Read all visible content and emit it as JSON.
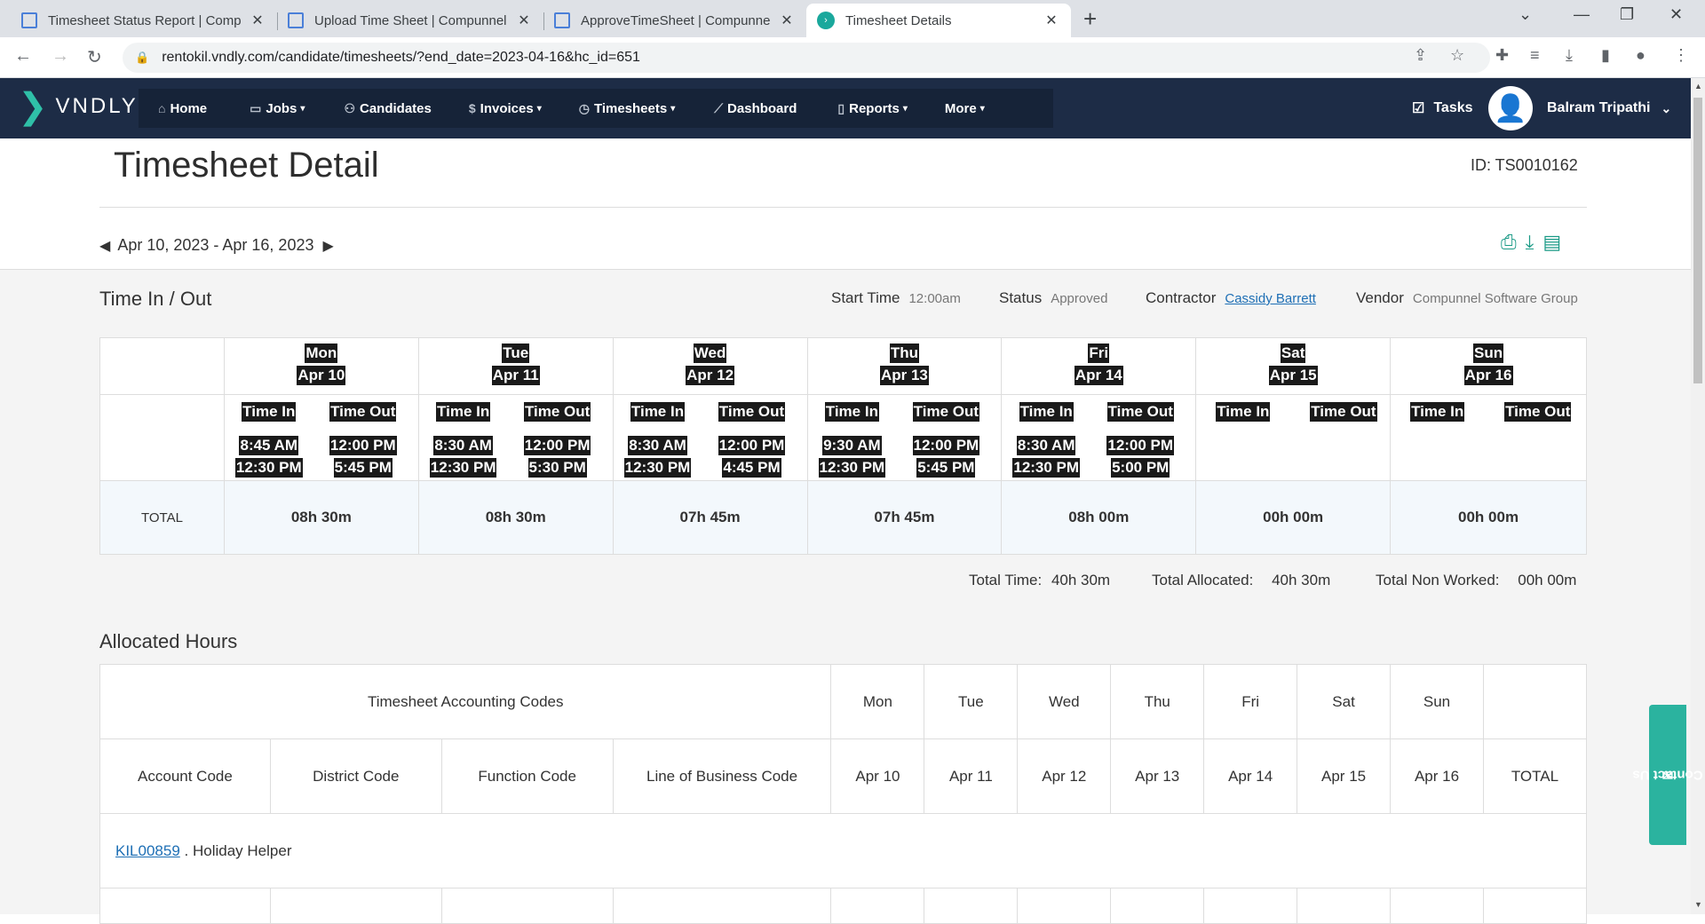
{
  "browser": {
    "tabs": [
      {
        "title": "Timesheet Status Report | Compunnel",
        "active": false
      },
      {
        "title": "Upload Time Sheet | Compunnel",
        "active": false
      },
      {
        "title": "ApproveTimeSheet | Compunnel",
        "active": false
      },
      {
        "title": "Timesheet Details",
        "active": true
      }
    ],
    "url": "rentokil.vndly.com/candidate/timesheets/?end_date=2023-04-16&hc_id=651"
  },
  "header": {
    "logo": "VNDLY",
    "menu": [
      {
        "label": "Home",
        "icon": "home-icon",
        "caret": false
      },
      {
        "label": "Jobs",
        "icon": "briefcase-icon",
        "caret": true
      },
      {
        "label": "Candidates",
        "icon": "user-icon",
        "caret": false
      },
      {
        "label": "Invoices",
        "icon": "dollar-icon",
        "caret": true
      },
      {
        "label": "Timesheets",
        "icon": "clock-icon",
        "caret": true
      },
      {
        "label": "Dashboard",
        "icon": "chart-icon",
        "caret": false
      },
      {
        "label": "Reports",
        "icon": "document-icon",
        "caret": true
      },
      {
        "label": "More",
        "icon": "",
        "caret": true
      }
    ],
    "tasks_label": "Tasks",
    "user_name": "Balram Tripathi"
  },
  "page": {
    "title": "Timesheet Detail",
    "id_label": "ID: TS0010162",
    "period": "Apr 10, 2023 - Apr 16, 2023"
  },
  "time_in_out": {
    "section_title": "Time In / Out",
    "start_time_label": "Start Time",
    "start_time_value": "12:00am",
    "status_label": "Status",
    "status_value": "Approved",
    "contractor_label": "Contractor",
    "contractor_value": "Cassidy Barrett",
    "vendor_label": "Vendor",
    "vendor_value": "Compunnel Software Group",
    "time_in_label": "Time In",
    "time_out_label": "Time Out",
    "total_label": "TOTAL",
    "days": [
      {
        "day": "Mon",
        "date": "Apr 10",
        "in": [
          "8:45 AM",
          "12:30 PM"
        ],
        "out": [
          "12:00 PM",
          "5:45 PM"
        ],
        "total": "08h 30m"
      },
      {
        "day": "Tue",
        "date": "Apr 11",
        "in": [
          "8:30 AM",
          "12:30 PM"
        ],
        "out": [
          "12:00 PM",
          "5:30 PM"
        ],
        "total": "08h 30m"
      },
      {
        "day": "Wed",
        "date": "Apr 12",
        "in": [
          "8:30 AM",
          "12:30 PM"
        ],
        "out": [
          "12:00 PM",
          "4:45 PM"
        ],
        "total": "07h 45m"
      },
      {
        "day": "Thu",
        "date": "Apr 13",
        "in": [
          "9:30 AM",
          "12:30 PM"
        ],
        "out": [
          "12:00 PM",
          "5:45 PM"
        ],
        "total": "07h 45m"
      },
      {
        "day": "Fri",
        "date": "Apr 14",
        "in": [
          "8:30 AM",
          "12:30 PM"
        ],
        "out": [
          "12:00 PM",
          "5:00 PM"
        ],
        "total": "08h 00m"
      },
      {
        "day": "Sat",
        "date": "Apr 15",
        "in": [],
        "out": [],
        "total": "00h 00m"
      },
      {
        "day": "Sun",
        "date": "Apr 16",
        "in": [],
        "out": [],
        "total": "00h 00m"
      }
    ],
    "total_time_label": "Total Time:",
    "total_time_value": "40h 30m",
    "total_allocated_label": "Total Allocated:",
    "total_allocated_value": "40h 30m",
    "total_non_worked_label": "Total Non Worked:",
    "total_non_worked_value": "00h 00m"
  },
  "allocated": {
    "section_title": "Allocated Hours",
    "group_header": "Timesheet Accounting Codes",
    "code_headers": [
      "Account Code",
      "District Code",
      "Function Code",
      "Line of Business Code"
    ],
    "days": [
      "Mon",
      "Tue",
      "Wed",
      "Thu",
      "Fri",
      "Sat",
      "Sun"
    ],
    "dates": [
      "Apr 10",
      "Apr 11",
      "Apr 12",
      "Apr 13",
      "Apr 14",
      "Apr 15",
      "Apr 16"
    ],
    "total_header": "TOTAL",
    "row_code": "KIL00859",
    "row_desc": ". Holiday Helper"
  },
  "contact_us": "Contact Us"
}
